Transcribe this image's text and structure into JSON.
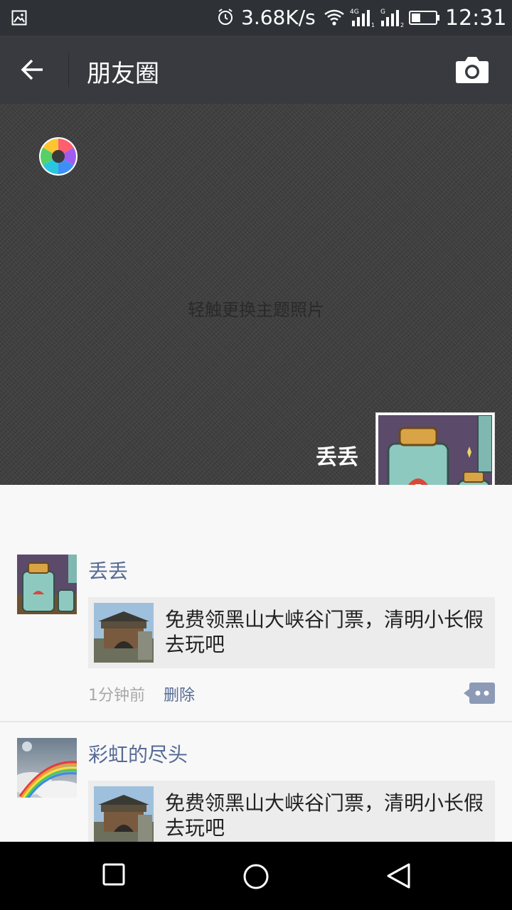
{
  "status_bar": {
    "network_speed": "3.68K/s",
    "time": "12:31",
    "icons": [
      "image-icon",
      "alarm-icon",
      "wifi-icon",
      "signal-4g-icon",
      "signal-g-icon",
      "battery-icon"
    ]
  },
  "header": {
    "title": "朋友圈",
    "back_icon": "arrow-left-icon",
    "camera_icon": "camera-icon"
  },
  "cover": {
    "hint": "轻触更换主题照片",
    "nickname": "丢丢"
  },
  "posts": [
    {
      "author": "丢丢",
      "share_text": "免费领黑山大峡谷门票，清明小长假去玩吧",
      "time_ago": "1分钟前",
      "delete_label": "删除"
    },
    {
      "author": "彩虹的尽头",
      "share_text": "免费领黑山大峡谷门票，清明小长假去玩吧"
    }
  ],
  "nav": {
    "icons": [
      "square-recents-icon",
      "circle-home-icon",
      "triangle-back-icon"
    ]
  },
  "colors": {
    "header_bg": "#393a3f",
    "status_bg": "#2e3135",
    "link_blue": "#576b95",
    "cover_bg": "#3f3f3f"
  }
}
